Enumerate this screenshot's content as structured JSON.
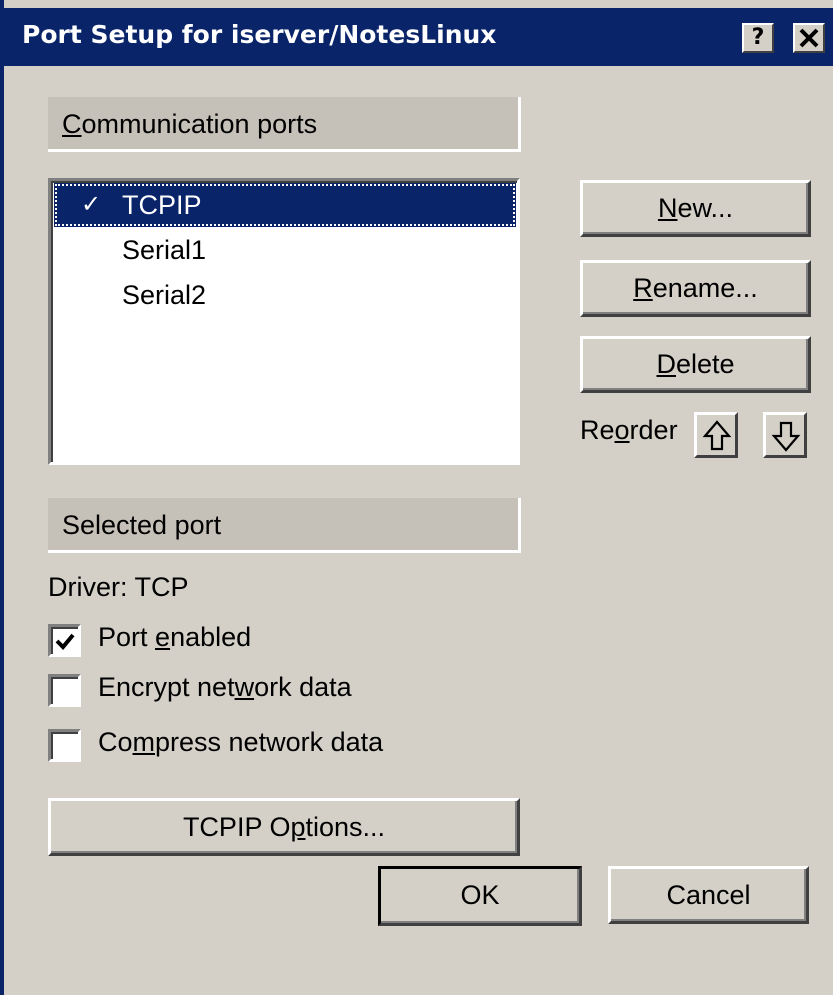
{
  "window": {
    "title": "Port Setup for iserver/NotesLinux",
    "help_label": "?",
    "close_label": "✕"
  },
  "communication_ports": {
    "header": "Communication ports",
    "items": [
      {
        "label": "TCPIP",
        "checked": true,
        "check_glyph": "✓",
        "selected": true
      },
      {
        "label": "Serial1",
        "checked": false,
        "check_glyph": "",
        "selected": false
      },
      {
        "label": "Serial2",
        "checked": false,
        "check_glyph": "",
        "selected": false
      }
    ]
  },
  "buttons": {
    "new_pre": "",
    "new_mn": "N",
    "new_post": "ew...",
    "rename_pre": "",
    "rename_mn": "R",
    "rename_post": "ename...",
    "delete_pre": "",
    "delete_mn": "D",
    "delete_post": "elete",
    "tcpip_pre": "TCPIP O",
    "tcpip_mn": "p",
    "tcpip_post": "tions...",
    "ok": "OK",
    "cancel": "Cancel"
  },
  "reorder": {
    "label_pre": "Re",
    "label_mn": "o",
    "label_post": "rder"
  },
  "selected_port": {
    "header": "Selected port",
    "driver": "Driver: TCP",
    "port_enabled": {
      "pre": "Port ",
      "mn": "e",
      "post": "nabled",
      "checked": true
    },
    "encrypt": {
      "pre": "Encrypt net",
      "mn": "w",
      "post": "ork data",
      "checked": false
    },
    "compress": {
      "pre": "Co",
      "mn": "m",
      "post": "press network data",
      "checked": false
    }
  },
  "colors": {
    "title_bar": "#0A246A",
    "face": "#D4D0C8",
    "selection": "#0A246A"
  }
}
